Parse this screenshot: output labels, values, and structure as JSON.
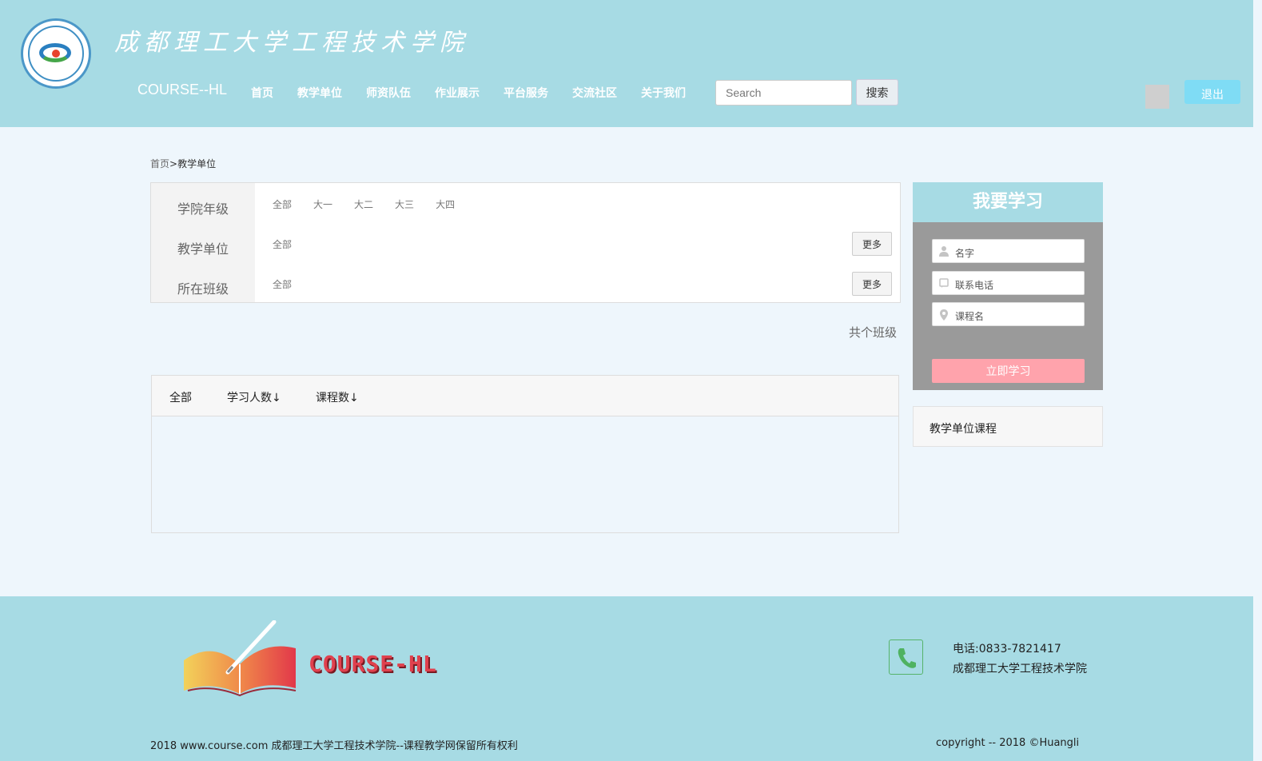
{
  "header": {
    "school_name": "成都理工大学工程技术学院",
    "brand": "COURSE--HL",
    "nav": [
      "首页",
      "教学单位",
      "师资队伍",
      "作业展示",
      "平台服务",
      "交流社区",
      "关于我们"
    ],
    "search_placeholder": "Search",
    "search_button": "搜索",
    "logout_button": "退出"
  },
  "breadcrumb": {
    "home": "首页",
    "sep": ">",
    "current": "教学单位"
  },
  "filter": {
    "rows": [
      {
        "label": "学院年级",
        "options": [
          "全部",
          "大一",
          "大二",
          "大三",
          "大四"
        ]
      },
      {
        "label": "教学单位",
        "options": [
          "全部"
        ],
        "more": "更多"
      },
      {
        "label": "所在班级",
        "options": [
          "全部"
        ],
        "more": "更多"
      }
    ]
  },
  "total_text": "共个班级",
  "sortbar": {
    "all": "全部",
    "students": "学习人数↓",
    "courses": "课程数↓"
  },
  "learn_form": {
    "title": "我要学习",
    "name_placeholder": "名字",
    "phone_placeholder": "联系电话",
    "course_placeholder": "课程名",
    "submit": "立即学习"
  },
  "unit_course": "教学单位课程",
  "footer": {
    "brand": "COURSE-HL",
    "phone": "电话:0833-7821417",
    "address": "成都理工大学工程技术学院",
    "copyright_left": "2018 www.course.com 成都理工大学工程技术学院--课程教学网保留所有权利",
    "copyright_right": "copyright -- 2018 ©Huangli"
  },
  "colors": {
    "header_bg": "#a7dbe4",
    "page_bg": "#eef6fc",
    "logout_bg": "#7fdcf5",
    "submit_bg": "#ffa3ac",
    "brand_red": "#e0414e"
  },
  "icons": [
    "school-logo-icon",
    "user-icon",
    "phone-field-icon",
    "location-icon",
    "phone-icon",
    "book-logo-icon"
  ]
}
